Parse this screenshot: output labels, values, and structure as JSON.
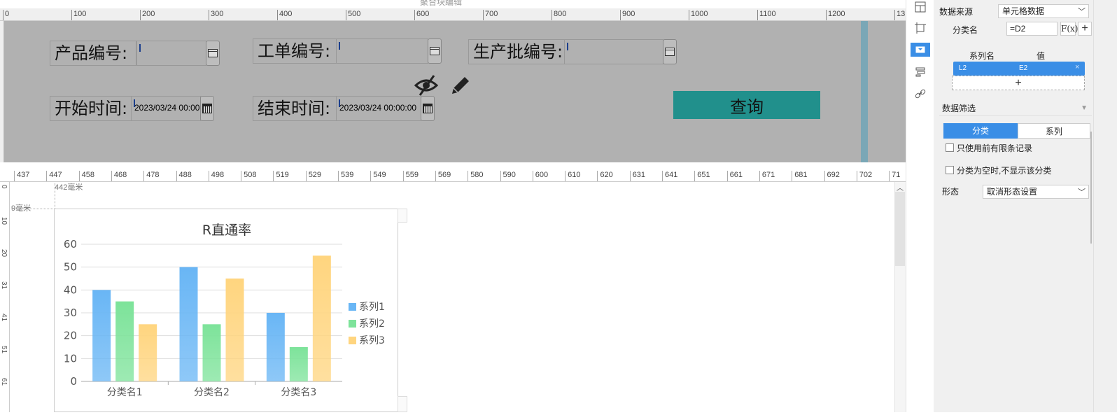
{
  "window_title": "聚合块编辑",
  "ruler_top": [
    "0",
    "100",
    "200",
    "300",
    "400",
    "500",
    "600",
    "700",
    "800",
    "900",
    "1000",
    "1100",
    "1200",
    "13"
  ],
  "form": {
    "product_no_label": "产品编号:",
    "work_order_label": "工单编号:",
    "batch_no_label": "生产批编号:",
    "start_time_label": "开始时间:",
    "start_time_value": "2023/03/24 00:00",
    "end_time_label": "结束时间:",
    "end_time_value": "2023/03/24 00:00:00",
    "query_button": "查询"
  },
  "ruler_bottom": [
    "437",
    "447",
    "458",
    "468",
    "478",
    "488",
    "498",
    "508",
    "519",
    "529",
    "539",
    "549",
    "559",
    "569",
    "580",
    "590",
    "600",
    "610",
    "620",
    "631",
    "641",
    "651",
    "661",
    "671",
    "681",
    "692",
    "702",
    "71"
  ],
  "ruler_left": [
    "0",
    "10",
    "20",
    "31",
    "41",
    "51",
    "61"
  ],
  "guides": {
    "x_label": "442毫米",
    "y_label": "9毫米"
  },
  "chart_data": {
    "type": "bar",
    "title": "R直通率",
    "categories": [
      "分类名1",
      "分类名2",
      "分类名3"
    ],
    "series": [
      {
        "name": "系列1",
        "values": [
          40,
          50,
          30
        ],
        "color": "#69b6f5"
      },
      {
        "name": "系列2",
        "values": [
          35,
          25,
          15
        ],
        "color": "#7de39a"
      },
      {
        "name": "系列3",
        "values": [
          25,
          45,
          55
        ],
        "color": "#ffd57f"
      }
    ],
    "ylim": [
      0,
      60
    ],
    "yticks": [
      "0",
      "10",
      "20",
      "30",
      "40",
      "50",
      "60"
    ],
    "legend": "right",
    "grid": true
  },
  "panel": {
    "data_source_label": "数据来源",
    "data_source_value": "单元格数据",
    "category_label": "分类名",
    "category_value": "=D2",
    "fx_label": "F(x)",
    "add_label": "+",
    "series_name_header": "系列名",
    "value_header": "值",
    "series_name_cell": "L2",
    "series_value_cell": "E2",
    "add_row": "+",
    "filter_header": "数据筛选",
    "seg_category": "分类",
    "seg_series": "系列",
    "option_limited": "只使用前有限条记录",
    "option_hide_empty": "分类为空时,不显示该分类",
    "morph_label": "形态",
    "morph_value": "取消形态设置"
  }
}
